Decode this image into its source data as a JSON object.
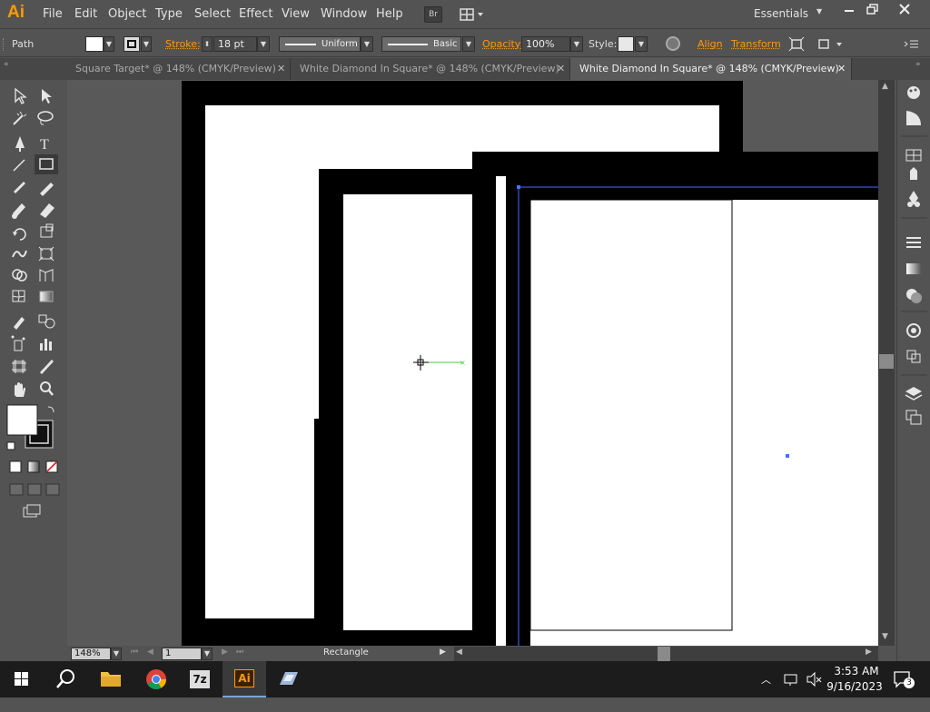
{
  "app": {
    "logo": "Ai"
  },
  "menu": [
    "File",
    "Edit",
    "Object",
    "Type",
    "Select",
    "Effect",
    "View",
    "Window",
    "Help"
  ],
  "bridge_label": "Br",
  "workspace": "Essentials",
  "control": {
    "selection_type": "Path",
    "stroke_label": "Stroke:",
    "stroke_weight": "18 pt",
    "variable_width": "Uniform",
    "brush": "Basic",
    "opacity_label": "Opacity:",
    "opacity_value": "100%",
    "style_label": "Style:",
    "align_label": "Align",
    "transform_label": "Transform"
  },
  "tabs": [
    {
      "label": "Square Target* @ 148% (CMYK/Preview)",
      "active": false
    },
    {
      "label": "White Diamond In Square* @ 148% (CMYK/Preview)",
      "active": false
    },
    {
      "label": "White Diamond In Square* @ 148% (CMYK/Preview)",
      "active": true
    }
  ],
  "status": {
    "zoom": "148%",
    "artboard": "1",
    "current_tool": "Rectangle"
  },
  "taskbar": {
    "time": "3:53 AM",
    "date": "9/16/2023",
    "notification_count": "3",
    "app_7z": "7z",
    "app_ai": "Ai"
  },
  "colors": {
    "accent": "#ff9a00",
    "ui_bg": "#535353",
    "canvas_bg": "#595959",
    "selection": "#4a6cff",
    "smart_guide": "#3fd13f"
  }
}
